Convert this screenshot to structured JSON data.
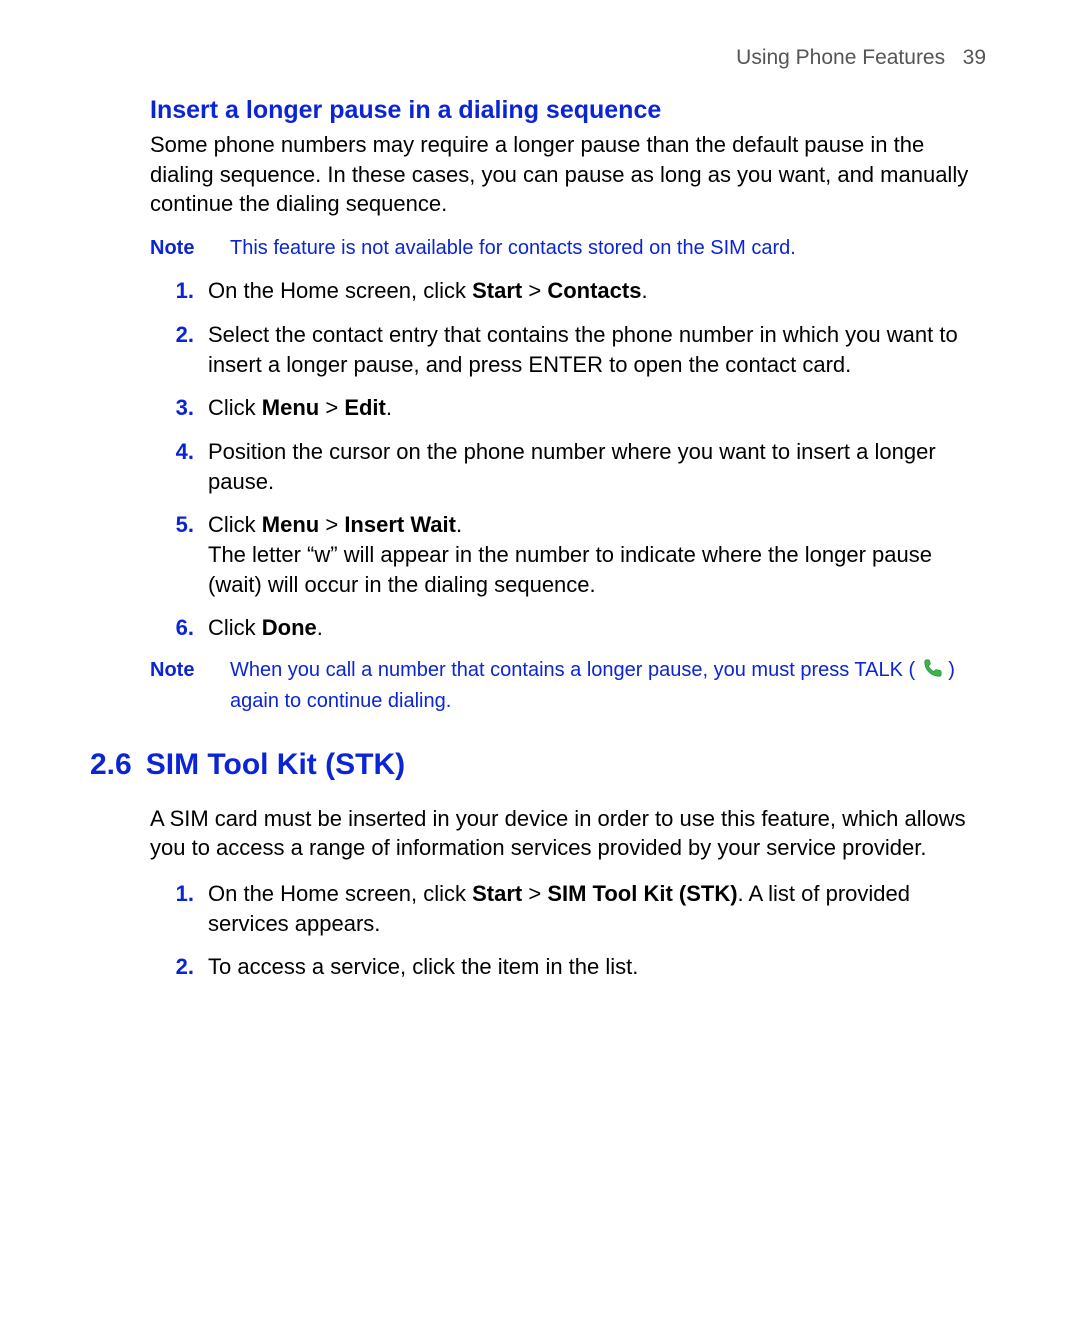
{
  "runhead": {
    "section": "Using Phone Features",
    "page": "39"
  },
  "sec1": {
    "heading": "Insert a longer pause in a dialing sequence",
    "intro": "Some phone numbers may require a longer pause than the default pause in the dialing sequence. In these cases, you can pause as long as you want, and manually continue the dialing sequence.",
    "note1": {
      "label": "Note",
      "text": "This feature is not available for contacts stored on the SIM card."
    },
    "steps": {
      "s1": {
        "num": "1.",
        "pre": "On the Home screen, click ",
        "b1": "Start",
        "mid": " > ",
        "b2": "Contacts",
        "post": "."
      },
      "s2": {
        "num": "2.",
        "text": "Select the contact entry that contains the phone number in which you want to insert a longer pause, and press ENTER to open the contact card."
      },
      "s3": {
        "num": "3.",
        "pre": "Click ",
        "b1": "Menu",
        "mid": " > ",
        "b2": "Edit",
        "post": "."
      },
      "s4": {
        "num": "4.",
        "text": "Position the cursor on the phone number where you want to insert a longer pause."
      },
      "s5": {
        "num": "5.",
        "pre": "Click ",
        "b1": "Menu",
        "mid": " > ",
        "b2": "Insert Wait",
        "post": ".",
        "extra": "The letter “w” will appear in the number to indicate where the longer pause (wait) will occur in the dialing sequence."
      },
      "s6": {
        "num": "6.",
        "pre": "Click ",
        "b1": "Done",
        "post": "."
      }
    },
    "note2": {
      "label": "Note",
      "pre": "When you call a number that contains a longer pause, you must press TALK ( ",
      "post": " ) again to continue dialing."
    }
  },
  "sec2": {
    "num": "2.6",
    "title": "SIM Tool Kit (STK)",
    "intro": "A SIM card must be inserted in your device in order to use this feature, which allows you to access a range of information services provided by your service provider.",
    "steps": {
      "s1": {
        "num": "1.",
        "pre": "On the Home screen, click ",
        "b1": "Start",
        "mid": " > ",
        "b2": "SIM Tool Kit (STK)",
        "post": ". A list of provided services appears."
      },
      "s2": {
        "num": "2.",
        "text": "To access a service, click the item in the list."
      }
    }
  }
}
